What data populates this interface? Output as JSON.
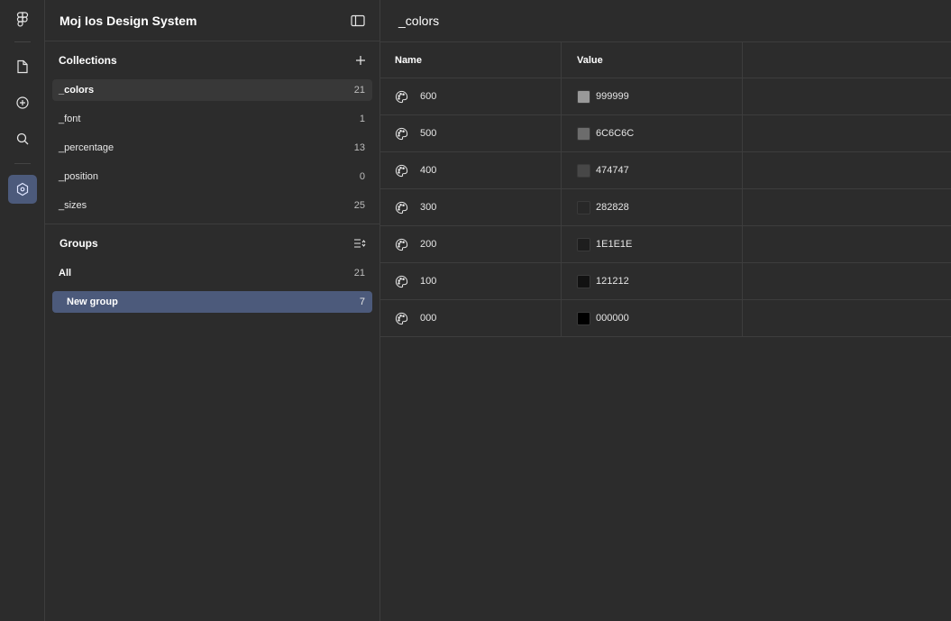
{
  "panel": {
    "title": "Moj Ios Design System"
  },
  "collections": {
    "title": "Collections",
    "items": [
      {
        "label": "_colors",
        "count": "21"
      },
      {
        "label": "_font",
        "count": "1"
      },
      {
        "label": "_percentage",
        "count": "13"
      },
      {
        "label": "_position",
        "count": "0"
      },
      {
        "label": "_sizes",
        "count": "25"
      }
    ]
  },
  "groups": {
    "title": "Groups",
    "items": [
      {
        "label": "All",
        "count": "21"
      },
      {
        "label": "New group",
        "count": "7"
      }
    ]
  },
  "main": {
    "title": "_colors",
    "columns": {
      "name": "Name",
      "value": "Value"
    },
    "rows": [
      {
        "name": "600",
        "value": "999999",
        "color": "#999999"
      },
      {
        "name": "500",
        "value": "6C6C6C",
        "color": "#6c6c6c"
      },
      {
        "name": "400",
        "value": "474747",
        "color": "#474747"
      },
      {
        "name": "300",
        "value": "282828",
        "color": "#282828"
      },
      {
        "name": "200",
        "value": "1E1E1E",
        "color": "#1e1e1e"
      },
      {
        "name": "100",
        "value": "121212",
        "color": "#121212"
      },
      {
        "name": "000",
        "value": "000000",
        "color": "#000000"
      }
    ]
  },
  "icons": {
    "rail": [
      "figma-icon",
      "file-icon",
      "plus-circle-icon",
      "search-icon",
      "variables-icon"
    ],
    "panel_toggle": "sidebar-toggle-icon",
    "add": "plus-icon",
    "sort": "sort-icon",
    "row": "palette-icon"
  },
  "colors": {
    "background": "#2c2c2c",
    "accent": "#4c5a7b",
    "border": "#3d3d3d"
  }
}
